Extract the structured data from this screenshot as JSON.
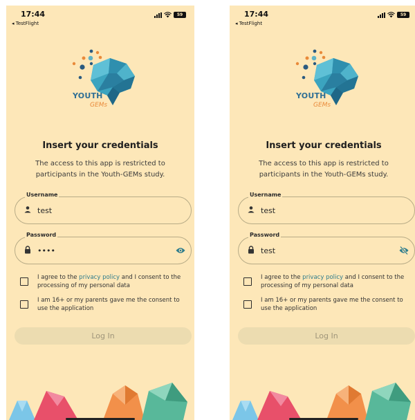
{
  "screens": [
    {
      "status": {
        "time": "17:44",
        "back": "◂ TestFlight",
        "battery": "59"
      },
      "logo": {
        "line1": "YOUTH",
        "line2": "GEMs"
      },
      "title": "Insert your credentials",
      "subtitle": "The access to this app is restricted to participants in the Youth-GEMs study.",
      "username": {
        "label": "Username",
        "value": "test"
      },
      "password": {
        "label": "Password",
        "value": "••••",
        "visibility_icon": "eye-icon"
      },
      "consent1": {
        "before": "I agree to the ",
        "link": "privacy policy",
        "after": " and I consent to the processing of my personal data"
      },
      "consent2": {
        "text": "I am 16+ or my parents gave me the consent to use the application"
      },
      "login_label": "Log In"
    },
    {
      "status": {
        "time": "17:44",
        "back": "◂ TestFlight",
        "battery": "59"
      },
      "logo": {
        "line1": "YOUTH",
        "line2": "GEMs"
      },
      "title": "Insert your credentials",
      "subtitle": "The access to this app is restricted to participants in the Youth-GEMs study.",
      "username": {
        "label": "Username",
        "value": "test"
      },
      "password": {
        "label": "Password",
        "value": "test",
        "visibility_icon": "eye-off-icon"
      },
      "consent1": {
        "before": "I agree to the ",
        "link": "privacy policy",
        "after": " and I consent to the processing of my personal data"
      },
      "consent2": {
        "text": "I am 16+ or my parents gave me the consent to use the application"
      },
      "login_label": "Log In"
    }
  ],
  "colors": {
    "background": "#fde7b8",
    "accent": "#2e7c8c",
    "button": "#ecdcb0"
  }
}
